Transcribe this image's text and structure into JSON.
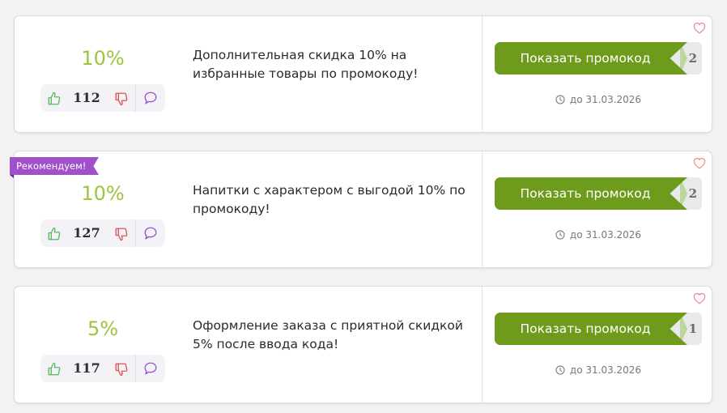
{
  "colors": {
    "discount": "#9bc53d",
    "button": "#6e9b1c",
    "badge": "#a050c8",
    "thumb_up": "#5cb85c",
    "thumb_down": "#e05252",
    "comment": "#a050c8",
    "heart": "#e88a8a"
  },
  "icons": [
    "thumbs-up-icon",
    "thumbs-down-icon",
    "comment-icon",
    "clock-icon",
    "heart-icon"
  ],
  "badge": {
    "label": "Рекомендуем!"
  },
  "coupons": [
    {
      "discount": "10%",
      "votes": "112",
      "description": "Дополнительная скидка 10% на избранные товары по промокоду!",
      "button_label": "Показать промокод",
      "count": "2",
      "expiry": "до 31.03.2026"
    },
    {
      "discount": "10%",
      "votes": "127",
      "description": "Напитки с характером с выгодой 10% по промокоду!",
      "button_label": "Показать промокод",
      "count": "2",
      "expiry": "до 31.03.2026"
    },
    {
      "discount": "5%",
      "votes": "117",
      "description": "Оформление заказа с приятной скидкой 5% после ввода кода!",
      "button_label": "Показать промокод",
      "count": "1",
      "expiry": "до 31.03.2026"
    }
  ]
}
